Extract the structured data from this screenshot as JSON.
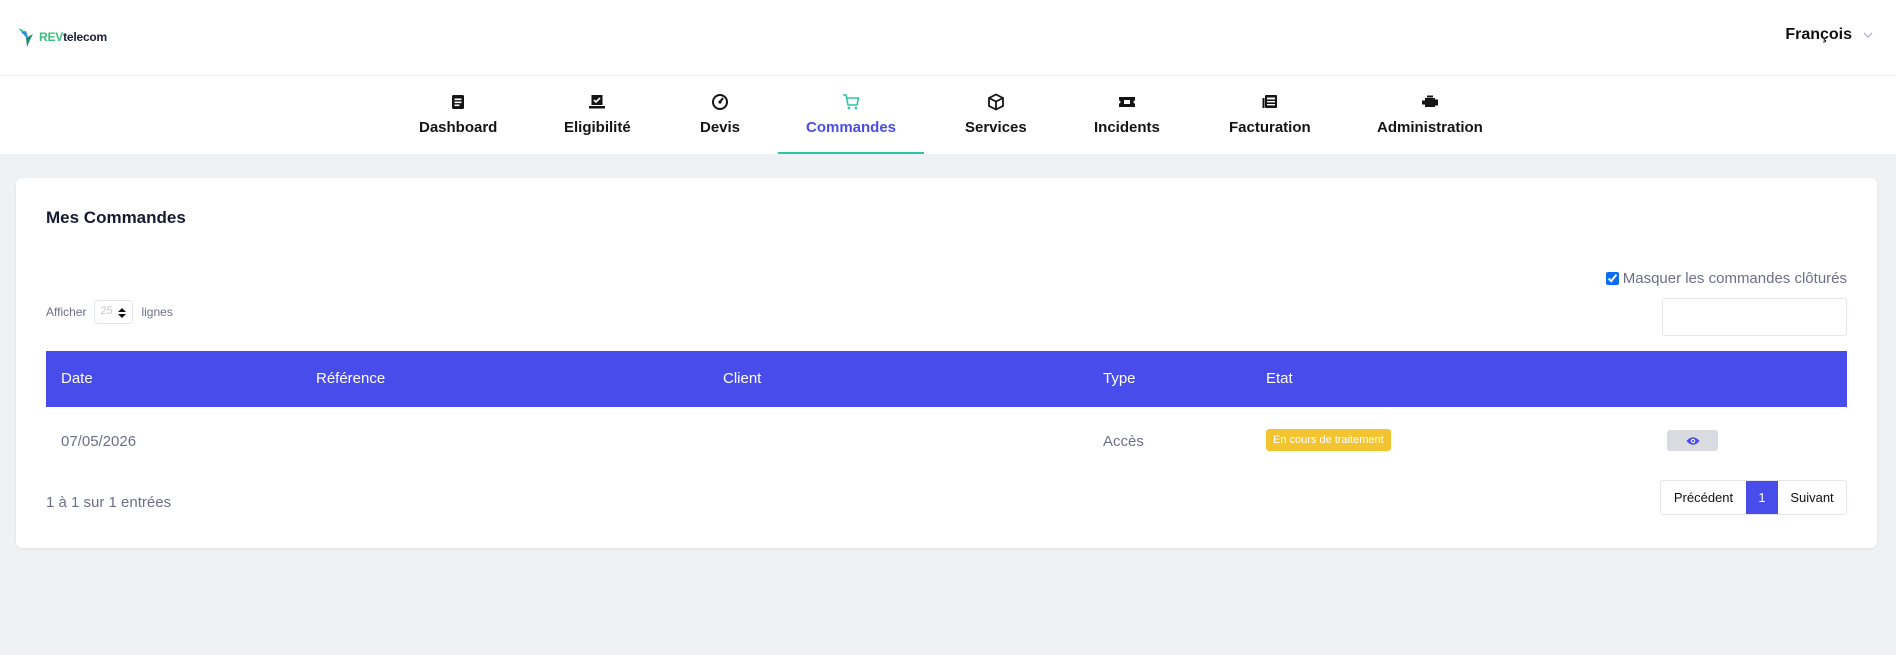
{
  "brand": {
    "part1": "REV",
    "part2": "telecom",
    "accent": "#39c27a"
  },
  "user": {
    "name": "François"
  },
  "nav": {
    "items": [
      {
        "label": "Dashboard",
        "icon": "document-icon"
      },
      {
        "label": "Eligibilité",
        "icon": "laptop-check-icon"
      },
      {
        "label": "Devis",
        "icon": "gauge-icon"
      },
      {
        "label": "Commandes",
        "icon": "cart-icon",
        "active": true
      },
      {
        "label": "Services",
        "icon": "box-icon"
      },
      {
        "label": "Incidents",
        "icon": "ticket-icon"
      },
      {
        "label": "Facturation",
        "icon": "newspaper-icon"
      },
      {
        "label": "Administration",
        "icon": "engine-icon"
      }
    ],
    "active_color": "#4a4ee8",
    "underline_color": "#2ec4a7"
  },
  "page": {
    "title": "Mes Commandes"
  },
  "filters": {
    "hide_closed_label": "Masquer les commandes clôturés",
    "hide_closed_checked": true,
    "show_label": "Afficher",
    "show_value": "25",
    "rows_label": "lignes",
    "search_value": ""
  },
  "table": {
    "header_color": "#474ceb",
    "columns": [
      "Date",
      "Référence",
      "Client",
      "Type",
      "Etat"
    ],
    "rows": [
      {
        "date": "07/05/2026",
        "reference": "",
        "client": "",
        "type": "Accès",
        "etat": "En cours de traitement",
        "etat_color": "#f4c430"
      }
    ]
  },
  "footer": {
    "info": "1 à 1 sur 1 entrées",
    "prev": "Précédent",
    "page": "1",
    "next": "Suivant"
  }
}
